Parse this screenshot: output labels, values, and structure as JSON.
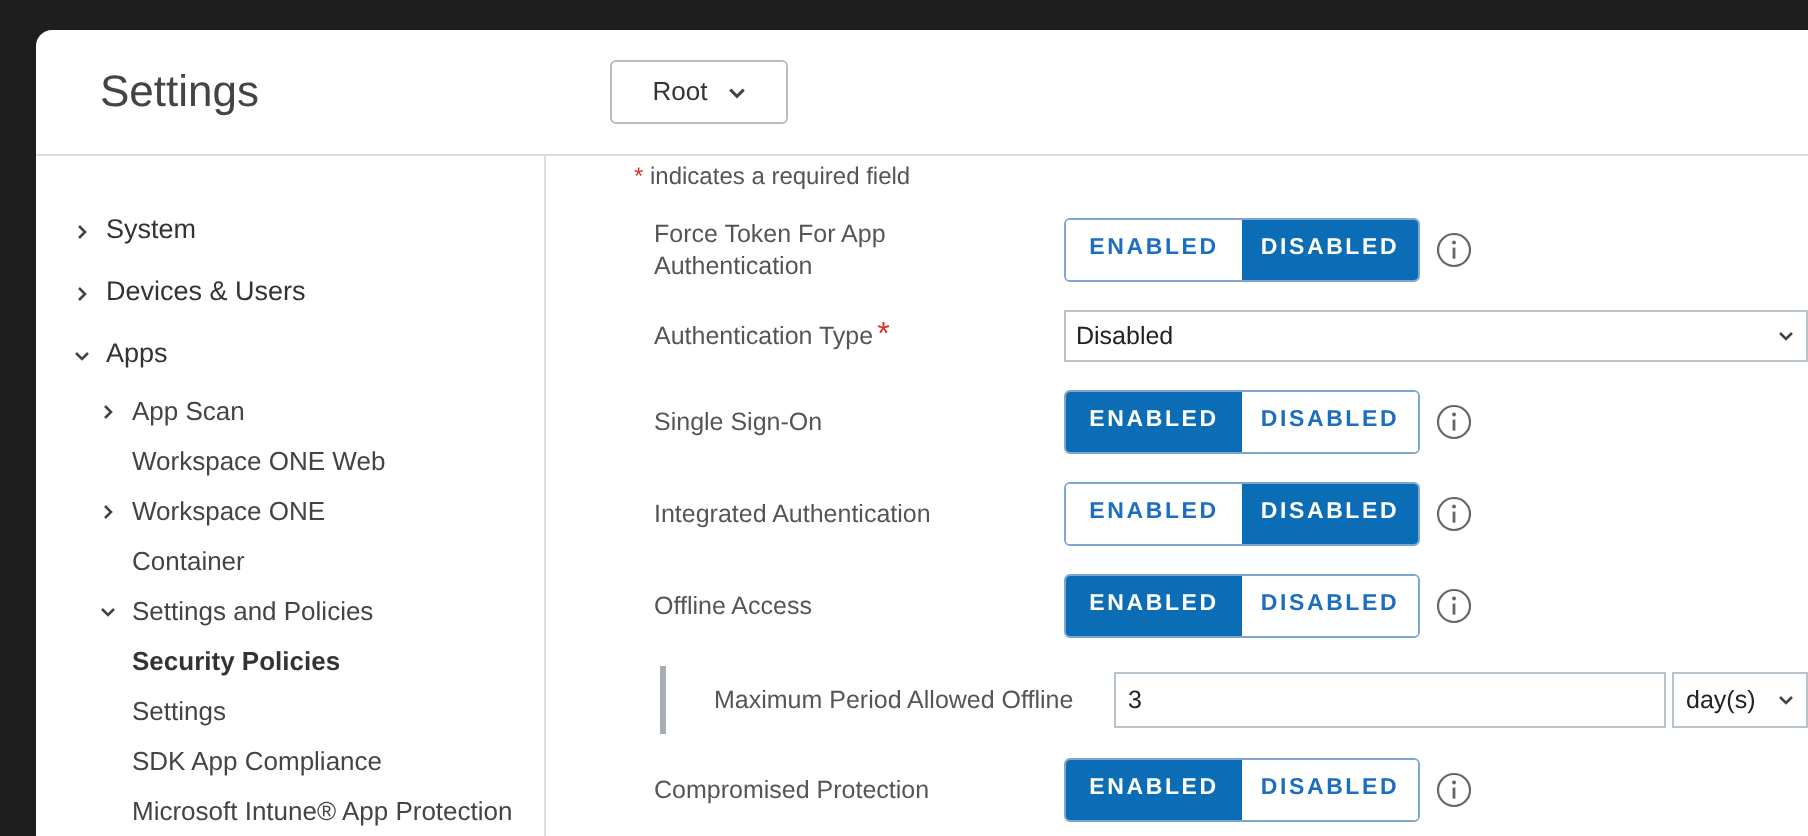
{
  "header": {
    "title": "Settings",
    "org_dropdown": "Root"
  },
  "sidebar": {
    "items": [
      {
        "label": "System",
        "expanded": false,
        "selected": false
      },
      {
        "label": "Devices & Users",
        "expanded": false,
        "selected": false
      },
      {
        "label": "Apps",
        "expanded": true,
        "selected": false,
        "children": [
          {
            "label": "App Scan",
            "expanded": false,
            "selected": false
          },
          {
            "label": "Workspace ONE Web",
            "selected": false
          },
          {
            "label": "Workspace ONE",
            "expanded": false,
            "selected": false
          },
          {
            "label": "Container",
            "selected": false
          },
          {
            "label": "Settings and Policies",
            "expanded": true,
            "selected": false,
            "children": [
              {
                "label": "Security Policies",
                "selected": true
              },
              {
                "label": "Settings",
                "selected": false
              },
              {
                "label": "SDK App Compliance",
                "selected": false
              }
            ]
          },
          {
            "label": "Microsoft Intune® App Protection",
            "selected": false
          }
        ]
      }
    ]
  },
  "form": {
    "required_mark": "*",
    "required_note": "indicates a required field",
    "fields": [
      {
        "kind": "toggle",
        "label": "Force Token For App Authentication",
        "info": true,
        "options": [
          {
            "label": "ENABLED",
            "selected": false
          },
          {
            "label": "DISABLED",
            "selected": true
          }
        ]
      },
      {
        "kind": "select",
        "label": "Authentication Type",
        "required": true,
        "value": "Disabled"
      },
      {
        "kind": "toggle",
        "label": "Single Sign-On",
        "info": true,
        "options": [
          {
            "label": "ENABLED",
            "selected": true
          },
          {
            "label": "DISABLED",
            "selected": false
          }
        ]
      },
      {
        "kind": "toggle",
        "label": "Integrated Authentication",
        "info": true,
        "options": [
          {
            "label": "ENABLED",
            "selected": false
          },
          {
            "label": "DISABLED",
            "selected": true
          }
        ]
      },
      {
        "kind": "toggle",
        "label": "Offline Access",
        "info": true,
        "options": [
          {
            "label": "ENABLED",
            "selected": true
          },
          {
            "label": "DISABLED",
            "selected": false
          }
        ]
      },
      {
        "kind": "sub_number",
        "label": "Maximum Period Allowed Offline",
        "value": "3",
        "unit": "day(s)"
      },
      {
        "kind": "toggle",
        "label": "Compromised Protection",
        "info": true,
        "options": [
          {
            "label": "ENABLED",
            "selected": true
          },
          {
            "label": "DISABLED",
            "selected": false
          }
        ]
      }
    ]
  }
}
